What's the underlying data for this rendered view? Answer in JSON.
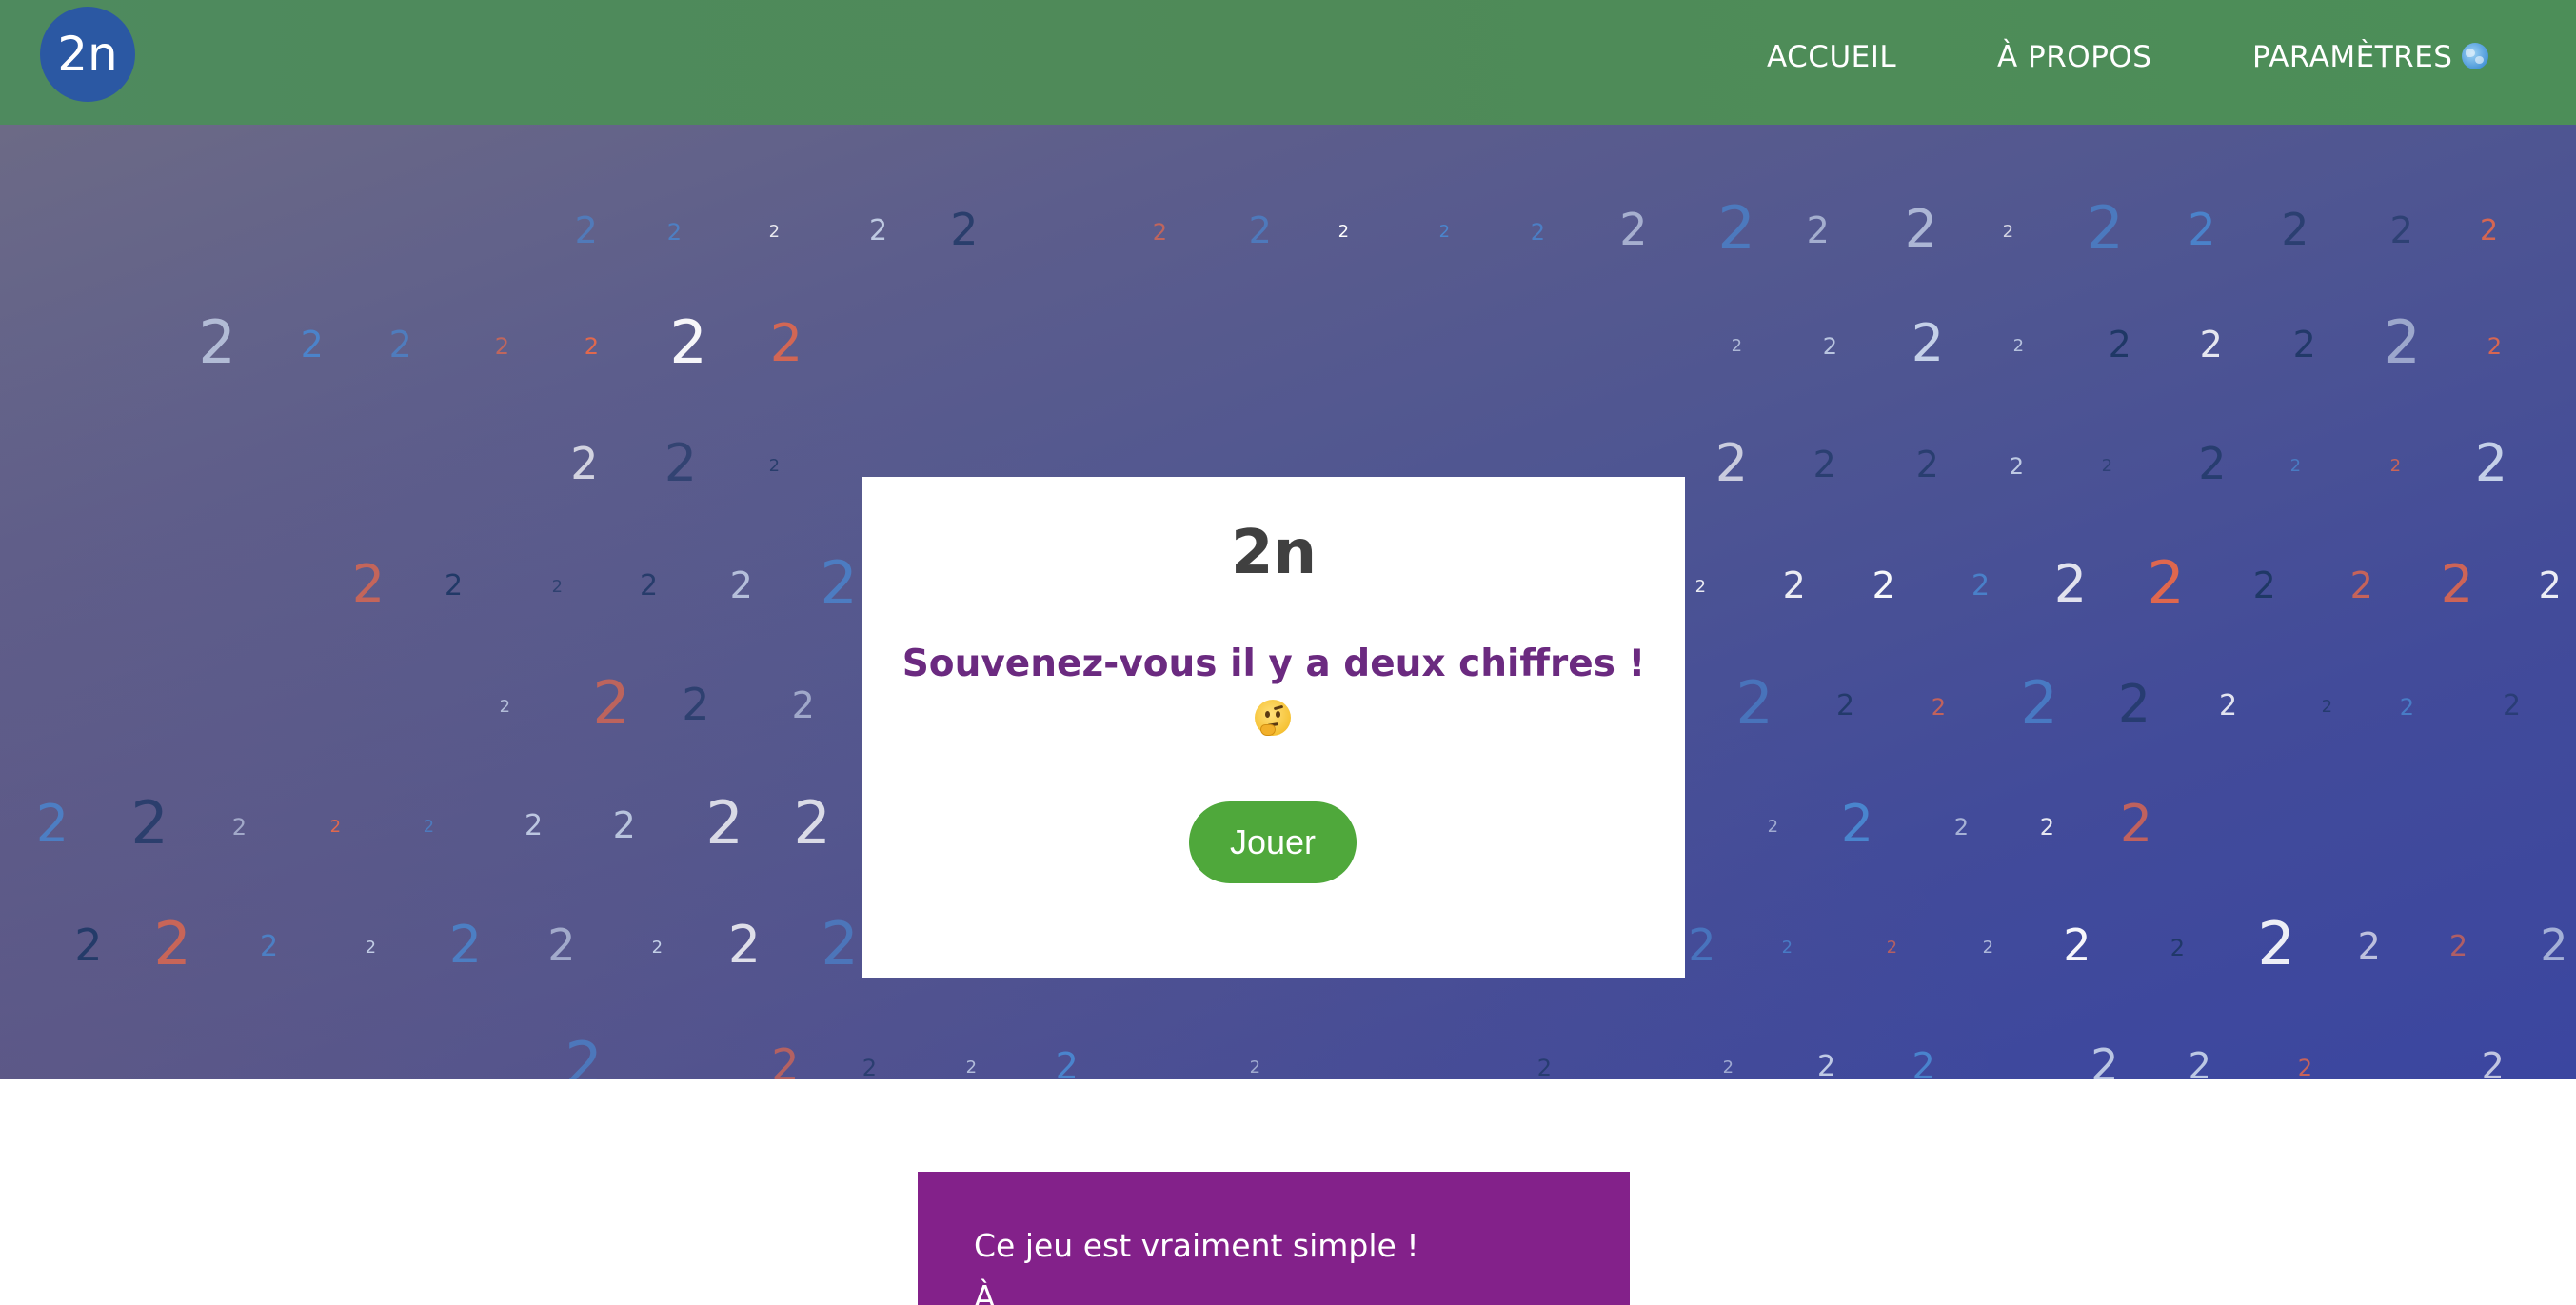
{
  "header": {
    "logo_text": "2n",
    "nav": {
      "home": "ACCUEIL",
      "about": "À PROPOS",
      "settings": "PARAMÈTRES"
    },
    "settings_icon": "globe-icon"
  },
  "background": {
    "digit": "2",
    "digit_colors": [
      "#1f3866",
      "#c7d3ea",
      "#4a86cf",
      "#e9694a",
      "#ffffff"
    ]
  },
  "modal": {
    "title": "2n",
    "message": "Souvenez-vous il y a deux chiffres !",
    "message_icon": "thinking-face-icon",
    "play_label": "Jouer"
  },
  "info": {
    "line1": "Ce jeu est vraiment simple !",
    "line2": "À"
  },
  "colors": {
    "nav_green": "#4e8a5e",
    "logo_blue": "#2b58a3",
    "message_purple": "#6b2a80",
    "play_green": "#4fa83b",
    "info_purple": "#83218a"
  }
}
